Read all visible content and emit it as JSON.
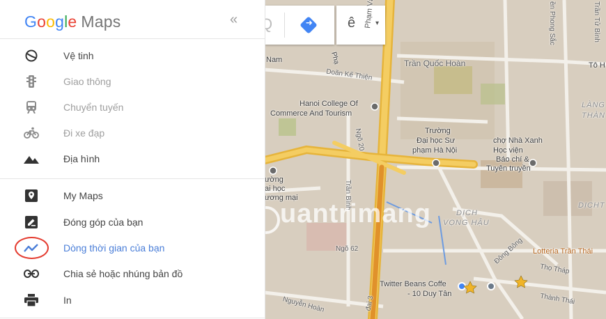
{
  "brand": {
    "letters": [
      "G",
      "o",
      "o",
      "g",
      "l",
      "e"
    ],
    "product": "Maps",
    "colors": [
      "#4285f4",
      "#ea4335",
      "#fbbc05",
      "#4285f4",
      "#34a853",
      "#ea4335"
    ]
  },
  "collapse_label": "«",
  "menu_group_1": [
    {
      "label": "Vệ tinh",
      "icon": "satellite-icon",
      "muted": false
    },
    {
      "label": "Giao thông",
      "icon": "traffic-light-icon",
      "muted": true
    },
    {
      "label": "Chuyển tuyến",
      "icon": "train-icon",
      "muted": true
    },
    {
      "label": "Đi xe đạp",
      "icon": "bicycle-icon",
      "muted": true
    },
    {
      "label": "Địa hình",
      "icon": "terrain-icon",
      "muted": false
    }
  ],
  "menu_group_2": [
    {
      "label": "My Maps",
      "icon": "map-pin-icon"
    },
    {
      "label": "Đóng góp của bạn",
      "icon": "edit-icon"
    },
    {
      "label": "Dòng thời gian của bạn",
      "icon": "timeline-icon",
      "active": true
    },
    {
      "label": "Chia sẻ hoặc nhúng bản đồ",
      "icon": "link-icon"
    },
    {
      "label": "In",
      "icon": "print-icon"
    }
  ],
  "accent_color": "#4a7ed8",
  "highlight_color": "#e43b2f",
  "map": {
    "toolbar": {
      "language_label": "ê",
      "dropdown": "▾",
      "search_glyph": "Q"
    },
    "labels": {
      "nam": "Nam",
      "pham": "Phạ",
      "doan_ke_thien": "Doãn Kế Thiện",
      "pham_van_dong": "Phạm Văn Đồng",
      "tran_quoc_hoan": "Trần Quốc Hoàn",
      "phong_sac": "ền Phong Sắc",
      "tran_tu_binh": "Trần Tử Bình",
      "to_h": "Tô H",
      "hanoi_college_1": "Hanoi College Of",
      "hanoi_college_2": "Commerce And Tourism",
      "lang": "LÀNG",
      "than": "THÀN",
      "ngo20": "Ngõ 20",
      "truong_1": "Trường",
      "truong_2": "Đại học Sư",
      "truong_3": "phạm Hà Nội",
      "cho_nha_xanh": "chợ Nhà Xanh",
      "hocvien_1": "Học viện",
      "hocvien_2": "Báo chí &",
      "hocvien_3": "Tuyên truyền",
      "truong_left_1": "ường",
      "truong_left_2": "ai học",
      "truong_left_3": "ương mại",
      "tran_binh": "Trần Bình",
      "dich_vong_hau_1": "DỊCH",
      "dich_vong_hau_2": "VỌNG HẬU",
      "dicht": "DỊCHT",
      "ngo62": "Ngõ 62",
      "dong_bong": "Đông Bông",
      "lotteria": "Lotteria Trần Thái",
      "tho_thap": "Thọ Tháp",
      "twitter_1": "Twitter Beans Coffe",
      "twitter_2": "- 10 Duy Tân",
      "thanh_thai": "Thành Thái",
      "nguyen_hoang": "Nguyễn Hoàn",
      "road3": "đai 3"
    },
    "watermark": "uantrimang"
  }
}
